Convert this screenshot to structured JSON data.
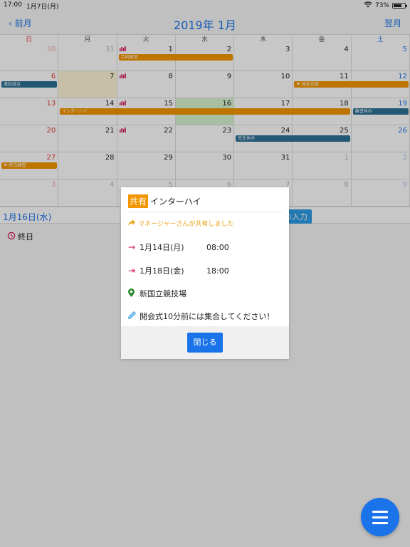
{
  "status": {
    "time": "17:00",
    "date": "1月7日(月)",
    "battery": "73%",
    "battery_level": 0.73
  },
  "nav": {
    "prev": "前月",
    "title": "2019年 1月",
    "next": "翌月"
  },
  "weekdays": [
    "日",
    "月",
    "火",
    "水",
    "木",
    "金",
    "土"
  ],
  "weeks": [
    [
      "30",
      "31",
      "1",
      "2",
      "3",
      "4",
      "5"
    ],
    [
      "6",
      "7",
      "8",
      "9",
      "10",
      "11",
      "12"
    ],
    [
      "13",
      "14",
      "15",
      "16",
      "17",
      "18",
      "19"
    ],
    [
      "20",
      "21",
      "22",
      "23",
      "24",
      "25",
      "26"
    ],
    [
      "27",
      "28",
      "29",
      "30",
      "31",
      "1",
      "2"
    ],
    [
      "3",
      "4",
      "5",
      "6",
      "7",
      "8",
      "9"
    ]
  ],
  "events": [
    {
      "label": "合同練習",
      "color": "#f29600"
    },
    {
      "label": "遠征試合",
      "color": "#2e7197"
    },
    {
      "label": "強化合宿",
      "color": "#f29600"
    },
    {
      "label": "インターハイ",
      "color": "#f29600"
    },
    {
      "label": "練習休み",
      "color": "#2e7197"
    },
    {
      "label": "先生休み",
      "color": "#2e7197"
    },
    {
      "label": "終日練習",
      "color": "#f29600"
    }
  ],
  "daybar": {
    "selected": "1月16日(水)",
    "add_button": "録の入力"
  },
  "allday": "終日",
  "modal": {
    "badge": "共有",
    "title": "インターハイ",
    "shared_by": "マネージャーさんが共有しました",
    "start_date": "1月14日(月)",
    "start_time": "08:00",
    "end_date": "1月18日(金)",
    "end_time": "18:00",
    "location": "新国立競技場",
    "memo": "開会式10分前には集合してください！",
    "close": "閉じる"
  },
  "colors": {
    "accent": "#1a73e8",
    "orange": "#f29600",
    "teal": "#2e7197",
    "sunday": "#e53935",
    "saturday": "#1a73e8"
  }
}
